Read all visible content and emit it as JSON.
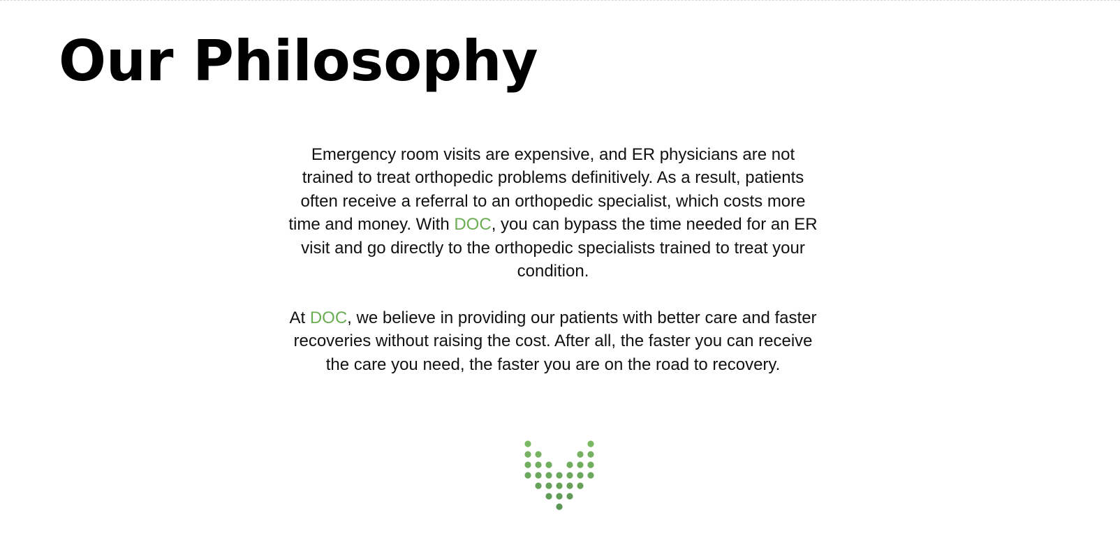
{
  "page": {
    "title": "Our Philosophy"
  },
  "philosophy": {
    "paragraph1": {
      "before_brand": "Emergency room visits are expensive, and ER physicians are not trained to treat orthopedic problems definitively. As a result, patients often receive a referral to an orthopedic specialist, which costs more time and money.  With ",
      "brand": "DOC",
      "after_brand": ", you can bypass the time needed for an ER visit and go directly to the orthopedic specialists trained to treat your condition."
    },
    "paragraph2": {
      "before_brand": "At ",
      "brand": "DOC",
      "after_brand": ", we believe in providing our patients with better care and faster recoveries without raising the cost. After all, the faster you can receive the care you need, the faster you are on the road to recovery."
    }
  },
  "colors": {
    "brand_green": "#6aad52",
    "logo_dot_light": "#7bb863",
    "logo_dot_dark": "#5b9654",
    "text": "#111111",
    "title": "#000000"
  },
  "logo": {
    "icon": "dotted-heart-v-icon"
  }
}
